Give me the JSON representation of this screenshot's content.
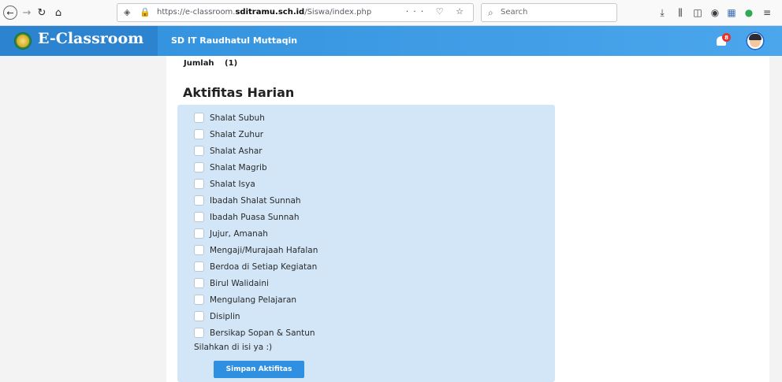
{
  "browser": {
    "url_prefix": "https://e-classroom.",
    "url_domain": "sditramu.sch.id",
    "url_path": "/Siswa/index.php",
    "url_actions": "··· ♡ ☆",
    "search_placeholder": "Search"
  },
  "header": {
    "brand": "E-Classroom",
    "school": "SD IT Raudhatul Muttaqin",
    "notification_count": "8"
  },
  "summary": {
    "jumlah_label": "Jumlah",
    "jumlah_value": "(1)"
  },
  "activities": {
    "title": "Aktifitas Harian",
    "items": [
      "Shalat Subuh",
      "Shalat Zuhur",
      "Shalat Ashar",
      "Shalat Magrib",
      "Shalat Isya",
      "Ibadah Shalat Sunnah",
      "Ibadah Puasa Sunnah",
      "Jujur, Amanah",
      "Mengaji/Murajaah Hafalan",
      "Berdoa di Setiap Kegiatan",
      "Birul Walidaini",
      "Mengulang Pelajaran",
      "Disiplin",
      "Bersikap Sopan & Santun"
    ],
    "hint": "Silahkan di isi ya :)",
    "save_label": "Simpan Aktifitas"
  },
  "colors": {
    "header_blue": "#2f8fdc",
    "panel_blue": "#d2e6f7",
    "button_blue": "#2f8fe0",
    "badge_red": "#e8322b"
  }
}
